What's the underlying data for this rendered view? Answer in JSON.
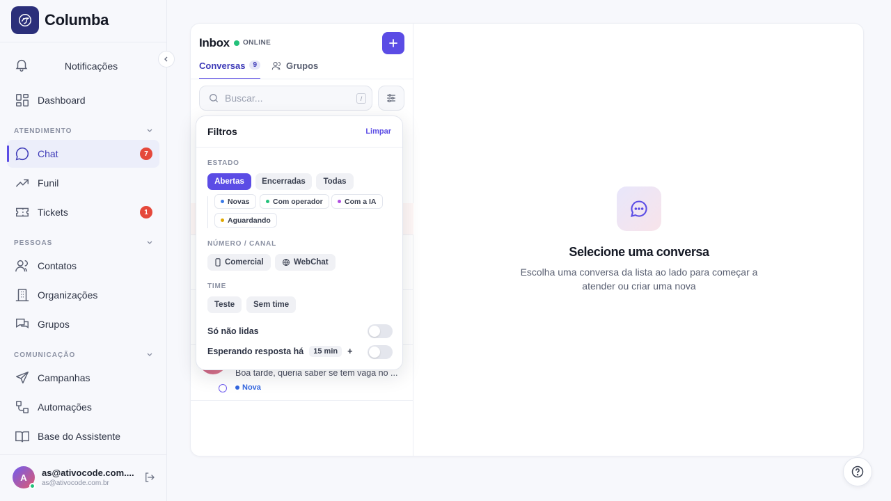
{
  "brand": {
    "name": "Columba"
  },
  "sidebar": {
    "notifications_label": "Notificações",
    "dashboard_label": "Dashboard",
    "sections": {
      "atendimento": "ATENDIMENTO",
      "pessoas": "PESSOAS",
      "comunicacao": "COMUNICAÇÃO"
    },
    "items": {
      "chat": {
        "label": "Chat",
        "badge": "7"
      },
      "funil": {
        "label": "Funil"
      },
      "tickets": {
        "label": "Tickets",
        "badge": "1"
      },
      "contatos": {
        "label": "Contatos"
      },
      "organizacoes": {
        "label": "Organizações"
      },
      "grupos": {
        "label": "Grupos"
      },
      "campanhas": {
        "label": "Campanhas"
      },
      "automacoes": {
        "label": "Automações"
      },
      "base": {
        "label": "Base do Assistente"
      }
    },
    "user": {
      "initial": "A",
      "name": "as@ativocode.com....",
      "email": "as@ativocode.com.br"
    }
  },
  "inbox": {
    "title": "Inbox",
    "status": "ONLINE",
    "tabs": {
      "conversas": "Conversas",
      "conversas_count": "9",
      "grupos": "Grupos"
    },
    "search_placeholder": "Buscar...",
    "search_shortcut": "/"
  },
  "conversation": {
    "preview": "Boa tarde, queria saber se tem vaga no ...",
    "tag": "Nova"
  },
  "filters": {
    "title": "Filtros",
    "clear": "Limpar",
    "estado_label": "ESTADO",
    "estado_options": {
      "abertas": "Abertas",
      "encerradas": "Encerradas",
      "todas": "Todas"
    },
    "sub_options": {
      "novas": "Novas",
      "com_operador": "Com operador",
      "com_ia": "Com a IA",
      "aguardando": "Aguardando"
    },
    "canal_label": "NÚMERO / CANAL",
    "canal_options": {
      "comercial": "Comercial",
      "webchat": "WebChat"
    },
    "time_label": "TIME",
    "time_options": {
      "teste": "Teste",
      "sem_time": "Sem time"
    },
    "unread_label": "Só não lidas",
    "waiting_label": "Esperando resposta há",
    "waiting_value": "15 min",
    "waiting_plus": "+"
  },
  "empty_state": {
    "title": "Selecione uma conversa",
    "subtitle": "Escolha uma conversa da lista ao lado para começar a atender ou criar uma nova"
  },
  "colors": {
    "accent": "#5b4ce5",
    "badge": "#e5483b",
    "online": "#23c17a",
    "novas_dot": "#3b7be8",
    "operador_dot": "#23c17a",
    "ia_dot": "#b04de0",
    "aguardando_dot": "#e0a800"
  }
}
